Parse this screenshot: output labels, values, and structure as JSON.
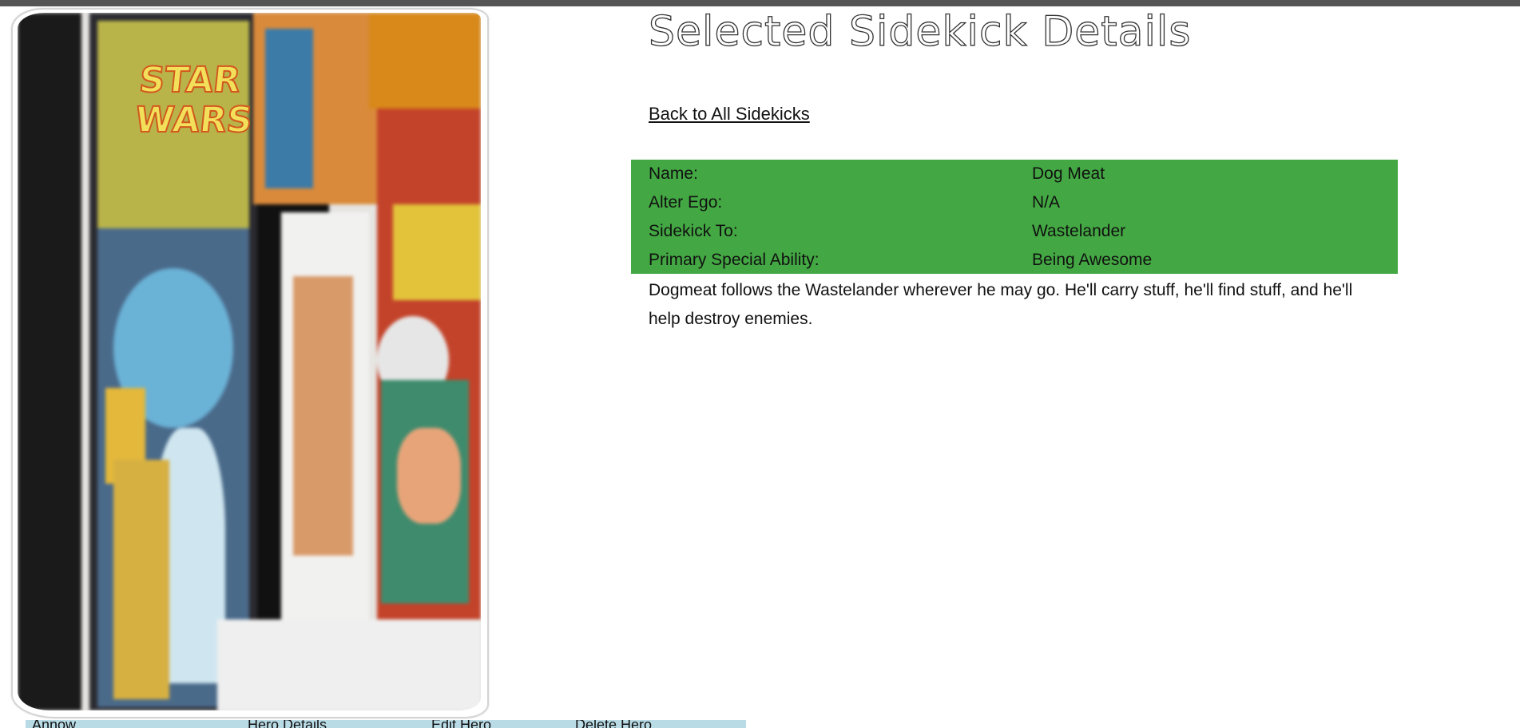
{
  "page": {
    "title": "Selected Sidekick Details",
    "back_link": "Back to All Sidekicks"
  },
  "details": [
    {
      "label": "Name:",
      "value": "Dog Meat"
    },
    {
      "label": "Alter Ego:",
      "value": "N/A"
    },
    {
      "label": "Sidekick To:",
      "value": "Wastelander"
    },
    {
      "label": "Primary Special Ability:",
      "value": "Being Awesome"
    }
  ],
  "description": "Dogmeat follows the Wastelander wherever he may go. He'll carry stuff, he'll find stuff, and he'll help destroy enemies.",
  "bottom_table": {
    "headers": [
      "Annow",
      "Hero Details",
      "Edit Hero",
      "Delete Hero"
    ]
  },
  "colors": {
    "top_bar": "#555555",
    "details_bg": "#43a843",
    "table_header_bg": "#b9dbe6"
  },
  "image": {
    "title_text": "STAR WARS",
    "alt": "comic books on a shelf"
  }
}
